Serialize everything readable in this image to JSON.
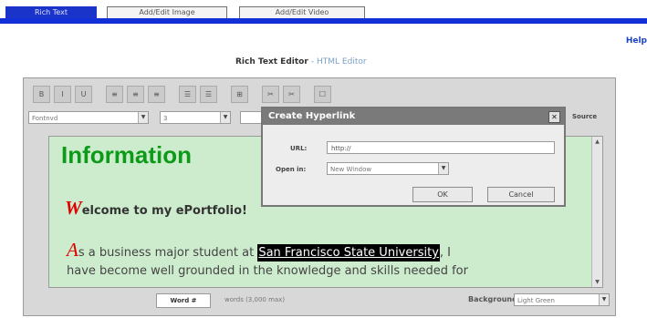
{
  "tabs": [
    {
      "label": "Rich Text"
    },
    {
      "label": "Add/Edit Image"
    },
    {
      "label": "Add/Edit Video"
    }
  ],
  "help_label": "Help",
  "editor": {
    "title": "Rich Text Editor",
    "mode_link": "- HTML Editor",
    "toolbar": [
      "B",
      "I",
      "U",
      "≡",
      "≡",
      "≡",
      "☰",
      "☰",
      "⊞",
      "✂",
      "✂",
      "☐"
    ],
    "font_select": "Fontnvd",
    "size_select": "3",
    "source_label": "Source",
    "content": {
      "heading": "Information",
      "heading_tail": "o",
      "welcome_initial": "W",
      "welcome_text": "elcome to my ePortfolio!",
      "para_initial": "A",
      "para_text_start": "s a business major student at ",
      "para_link": "San Francisco State University",
      "para_text_end": ", I",
      "para_line2": "have become well grounded in the knowledge and skills needed for"
    },
    "bottom": {
      "word_button": "Word #",
      "count_text": "words (3,000 max)",
      "background_label": "Background",
      "background_value": "Light Green"
    }
  },
  "dialog": {
    "title": "Create Hyperlink",
    "url_label": "URL:",
    "url_value": "http://",
    "open_in_label": "Open in:",
    "open_in_value": "New Window",
    "ok_label": "OK",
    "cancel_label": "Cancel"
  },
  "colors": {
    "tab_active": "#1a33c9",
    "heading_green": "#0c9a18",
    "content_bg": "#cdeccd",
    "initial_red": "#e00000"
  }
}
